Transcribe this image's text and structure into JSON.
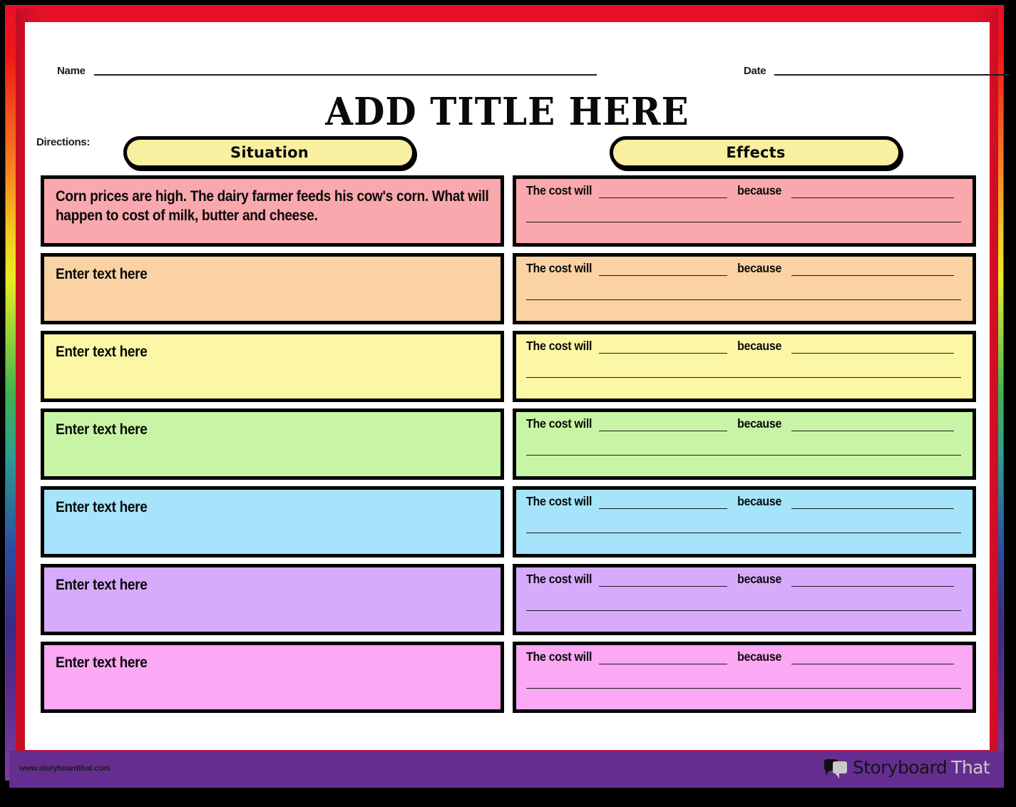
{
  "header": {
    "name_label": "Name",
    "date_label": "Date",
    "title": "ADD TITLE HERE",
    "directions_label": "Directions:"
  },
  "columns": {
    "situation_label": "Situation",
    "effects_label": "Effects"
  },
  "effects_template": {
    "prefix_label": "The cost will",
    "conjunction_label": "because"
  },
  "rows": [
    {
      "color": "#f9a8ad",
      "situation_text": "Corn prices are high. The dairy farmer feeds his cow's corn. What will happen to cost of milk, butter and cheese."
    },
    {
      "color": "#fbd2a4",
      "situation_text": "Enter text here"
    },
    {
      "color": "#fbf7a5",
      "situation_text": "Enter text here"
    },
    {
      "color": "#c8f5a5",
      "situation_text": "Enter text here"
    },
    {
      "color": "#a5e4fa",
      "situation_text": "Enter text here"
    },
    {
      "color": "#d7abfb",
      "situation_text": "Enter text here"
    },
    {
      "color": "#fba8f5",
      "situation_text": "Enter text here"
    }
  ],
  "footer": {
    "url": "www.storyboardthat.com",
    "logo_word_1": "Storyboard",
    "logo_word_2": "That"
  },
  "colors": {
    "frame_red": "#e8102a",
    "footer_purple": "#662d91",
    "pill_yellow": "#f8efa0",
    "border_black": "#000000"
  }
}
